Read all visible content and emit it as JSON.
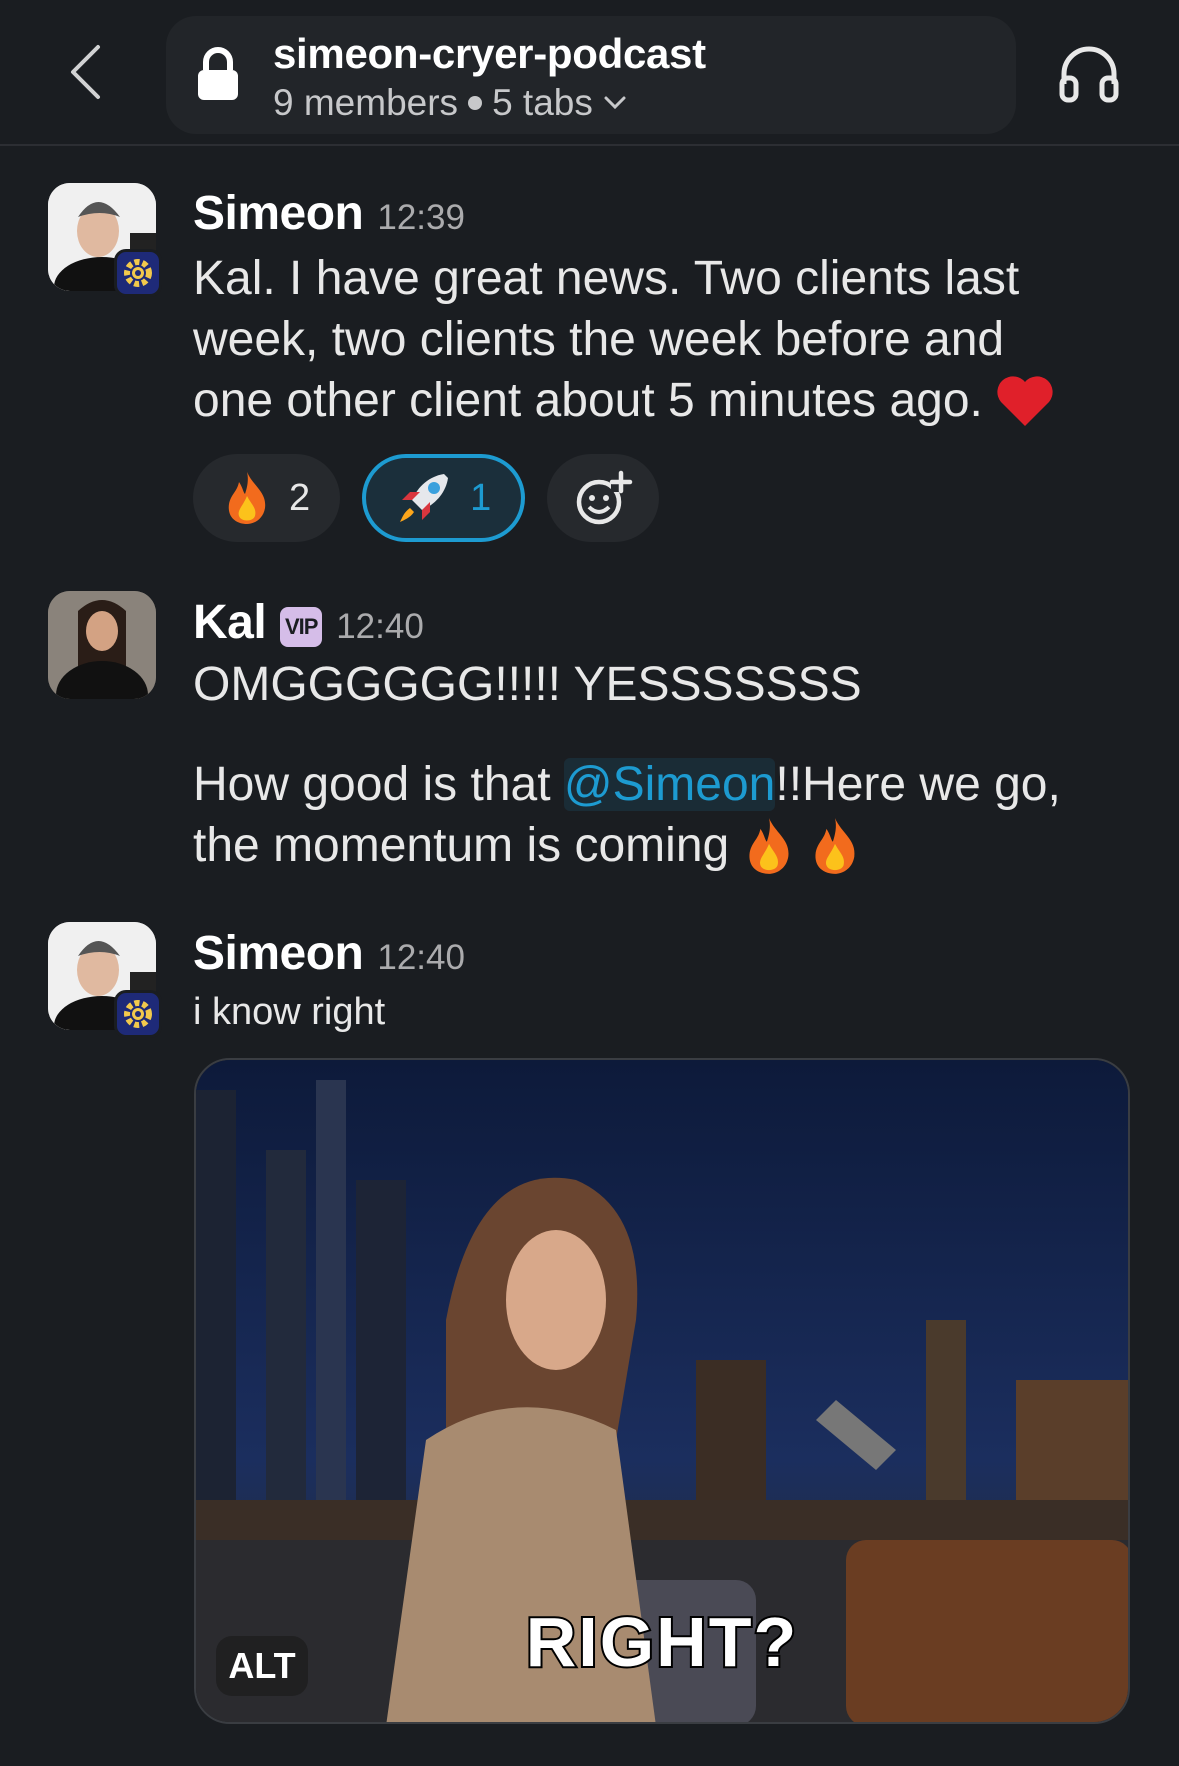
{
  "header": {
    "channel_name": "simeon-cryer-podcast",
    "members": "9 members",
    "tabs": "5 tabs",
    "icons": [
      "chevron-left-icon",
      "lock-icon",
      "chevron-down-icon",
      "headphones-icon"
    ]
  },
  "messages": [
    {
      "sender": "Simeon",
      "time": "12:39",
      "text_lines": [
        "Kal. I have great news. Two clients last",
        "week, two clients the week before and",
        "one other client about 5 minutes ago."
      ],
      "trailing_emoji": "heart",
      "reactions": [
        {
          "emoji": "fire",
          "count": "2",
          "active": false
        },
        {
          "emoji": "rocket",
          "count": "1",
          "active": true
        }
      ]
    },
    {
      "sender": "Kal",
      "badge": "VIP",
      "time": "12:40",
      "line1": "OMGGGGGG!!!!! YESSSSSSS",
      "line2_before": "How good is that ",
      "mention": "@Simeon",
      "line2_after": "!!Here we go,",
      "line3": "the momentum is coming",
      "trailing_emojis": [
        "fire",
        "fire"
      ]
    },
    {
      "sender": "Simeon",
      "time": "12:40",
      "text": "i know right",
      "gif": {
        "caption": "RIGHT?",
        "alt_label": "ALT"
      }
    }
  ],
  "colors": {
    "background": "#1a1d21",
    "accent": "#1d9bd1",
    "vip": "#d5bde8"
  }
}
